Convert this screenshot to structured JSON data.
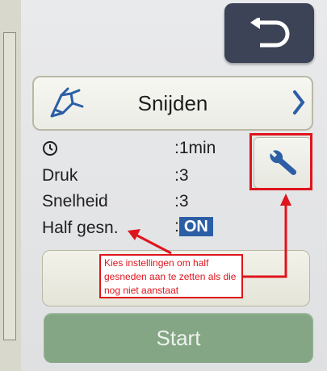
{
  "header": {
    "back_icon": "return-arrow-icon"
  },
  "mode_bar": {
    "label": "Snijden",
    "icon": "cutting-pen-icon",
    "chevron": "chevron-right-icon"
  },
  "settings": {
    "time_value": ":1min",
    "pressure_label": "Druk",
    "pressure_value": ":3",
    "speed_label": "Snelheid",
    "speed_value": ":3",
    "half_cut_label": "Half gesn.",
    "half_cut_prefix": ":",
    "half_cut_value": "ON"
  },
  "settings_button": {
    "icon": "wrench-icon"
  },
  "start_button": {
    "label": "Start",
    "enabled": false
  },
  "annotation": {
    "text": "Kies instellingen om half gesneden aan te zetten als die nog niet aanstaat"
  },
  "colors": {
    "accent_blue": "#2c5ea6",
    "annotation_red": "#e0141c",
    "start_disabled": "#84a684",
    "back_button": "#3c4356"
  }
}
